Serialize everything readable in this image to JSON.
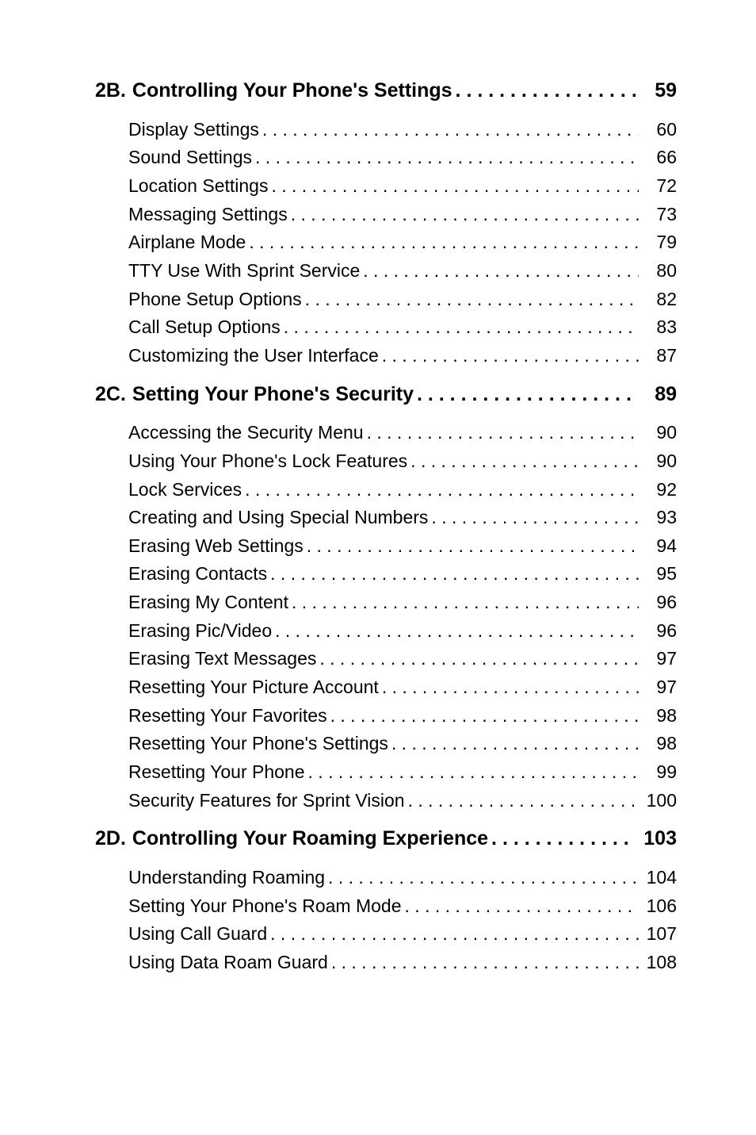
{
  "toc": [
    {
      "prefix": "2B.",
      "title": "Controlling Your Phone's Settings",
      "page": "59",
      "items": [
        {
          "label": "Display Settings",
          "page": "60"
        },
        {
          "label": "Sound Settings",
          "page": "66"
        },
        {
          "label": "Location Settings",
          "page": "72"
        },
        {
          "label": "Messaging Settings",
          "page": "73"
        },
        {
          "label": "Airplane Mode",
          "page": "79"
        },
        {
          "label": "TTY Use With Sprint Service",
          "page": "80"
        },
        {
          "label": "Phone Setup Options",
          "page": "82"
        },
        {
          "label": "Call Setup Options",
          "page": "83"
        },
        {
          "label": "Customizing the User Interface",
          "page": "87"
        }
      ]
    },
    {
      "prefix": "2C.",
      "title": "Setting Your Phone's Security",
      "page": "89",
      "items": [
        {
          "label": "Accessing the Security Menu",
          "page": "90"
        },
        {
          "label": "Using Your Phone's Lock Features",
          "page": "90"
        },
        {
          "label": "Lock Services",
          "page": "92"
        },
        {
          "label": "Creating and Using Special Numbers",
          "page": "93"
        },
        {
          "label": "Erasing Web Settings",
          "page": "94"
        },
        {
          "label": "Erasing Contacts",
          "page": "95"
        },
        {
          "label": "Erasing My Content",
          "page": "96"
        },
        {
          "label": "Erasing Pic/Video",
          "page": "96"
        },
        {
          "label": "Erasing Text Messages",
          "page": "97"
        },
        {
          "label": "Resetting Your Picture Account",
          "page": "97"
        },
        {
          "label": "Resetting Your Favorites",
          "page": "98"
        },
        {
          "label": "Resetting Your Phone's Settings",
          "page": "98"
        },
        {
          "label": "Resetting Your Phone",
          "page": "99"
        },
        {
          "label": "Security Features for Sprint Vision",
          "page": "100"
        }
      ]
    },
    {
      "prefix": "2D.",
      "title": "Controlling Your Roaming Experience",
      "page": "103",
      "items": [
        {
          "label": "Understanding Roaming",
          "page": "104"
        },
        {
          "label": "Setting Your Phone's Roam Mode",
          "page": "106"
        },
        {
          "label": "Using Call Guard",
          "page": "107"
        },
        {
          "label": "Using Data Roam Guard",
          "page": "108"
        }
      ]
    }
  ]
}
